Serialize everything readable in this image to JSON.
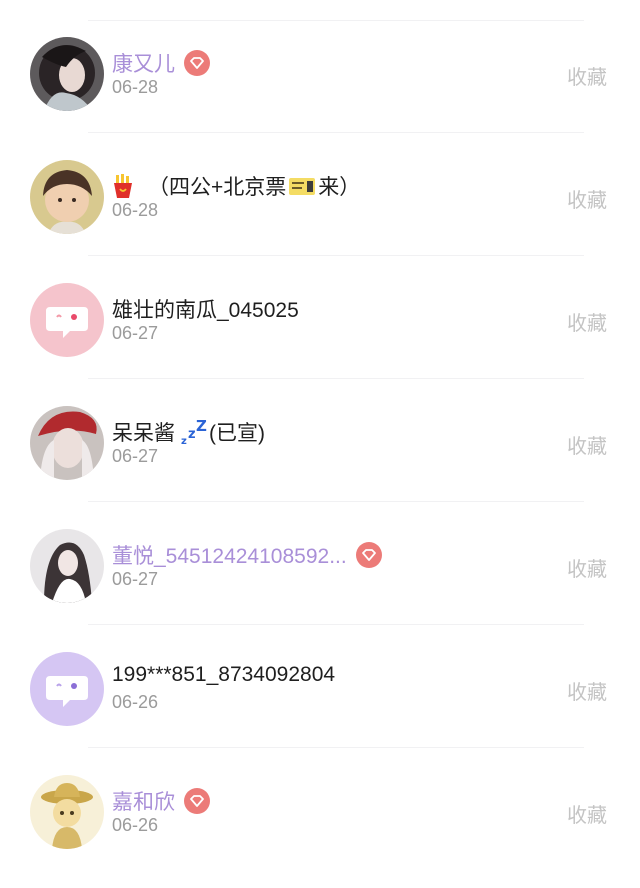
{
  "items": [
    {
      "name": "康又儿",
      "date": "06-28",
      "vip": true,
      "avatar": "portrait-dark-hair"
    },
    {
      "name_prefix": "（四公+北京票",
      "name_suffix": "来）",
      "date": "06-28",
      "vip": false,
      "avatar": "portrait-young-man",
      "emoji": [
        "fries-icon",
        "ticket-icon"
      ]
    },
    {
      "name": "雄壮的南瓜_045025",
      "date": "06-27",
      "vip": false,
      "avatar": "default-pink-chat-bubble"
    },
    {
      "name": "呆呆酱",
      "name_suffix": "(已宣)",
      "date": "06-27",
      "vip": false,
      "avatar": "portrait-red-hat",
      "emoji": [
        "zzz-icon"
      ]
    },
    {
      "name": "董悦_54512424108592...",
      "date": "06-27",
      "vip": true,
      "avatar": "portrait-anime-girl"
    },
    {
      "name": "199***851_8734092804",
      "date": "06-26",
      "vip": false,
      "avatar": "default-purple-chat-bubble"
    },
    {
      "name": "嘉和欣",
      "date": "06-26",
      "vip": true,
      "avatar": "cartoon-cowboy"
    }
  ],
  "collect_label": "收藏",
  "colors": {
    "vip_name": "#a98fd8",
    "vip_badge": "#ec7b78",
    "date": "#9b9b9b",
    "collect": "#c4c4c4"
  }
}
